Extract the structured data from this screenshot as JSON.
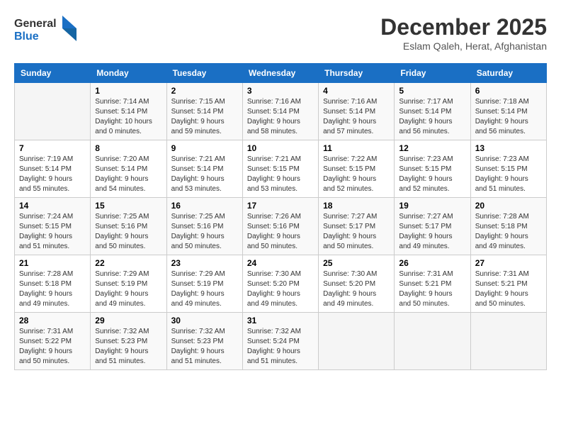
{
  "header": {
    "logo_line1": "General",
    "logo_line2": "Blue",
    "month_title": "December 2025",
    "location": "Eslam Qaleh, Herat, Afghanistan"
  },
  "weekdays": [
    "Sunday",
    "Monday",
    "Tuesday",
    "Wednesday",
    "Thursday",
    "Friday",
    "Saturday"
  ],
  "weeks": [
    [
      {
        "day": "",
        "sunrise": "",
        "sunset": "",
        "daylight": ""
      },
      {
        "day": "1",
        "sunrise": "Sunrise: 7:14 AM",
        "sunset": "Sunset: 5:14 PM",
        "daylight": "Daylight: 10 hours and 0 minutes."
      },
      {
        "day": "2",
        "sunrise": "Sunrise: 7:15 AM",
        "sunset": "Sunset: 5:14 PM",
        "daylight": "Daylight: 9 hours and 59 minutes."
      },
      {
        "day": "3",
        "sunrise": "Sunrise: 7:16 AM",
        "sunset": "Sunset: 5:14 PM",
        "daylight": "Daylight: 9 hours and 58 minutes."
      },
      {
        "day": "4",
        "sunrise": "Sunrise: 7:16 AM",
        "sunset": "Sunset: 5:14 PM",
        "daylight": "Daylight: 9 hours and 57 minutes."
      },
      {
        "day": "5",
        "sunrise": "Sunrise: 7:17 AM",
        "sunset": "Sunset: 5:14 PM",
        "daylight": "Daylight: 9 hours and 56 minutes."
      },
      {
        "day": "6",
        "sunrise": "Sunrise: 7:18 AM",
        "sunset": "Sunset: 5:14 PM",
        "daylight": "Daylight: 9 hours and 56 minutes."
      }
    ],
    [
      {
        "day": "7",
        "sunrise": "Sunrise: 7:19 AM",
        "sunset": "Sunset: 5:14 PM",
        "daylight": "Daylight: 9 hours and 55 minutes."
      },
      {
        "day": "8",
        "sunrise": "Sunrise: 7:20 AM",
        "sunset": "Sunset: 5:14 PM",
        "daylight": "Daylight: 9 hours and 54 minutes."
      },
      {
        "day": "9",
        "sunrise": "Sunrise: 7:21 AM",
        "sunset": "Sunset: 5:14 PM",
        "daylight": "Daylight: 9 hours and 53 minutes."
      },
      {
        "day": "10",
        "sunrise": "Sunrise: 7:21 AM",
        "sunset": "Sunset: 5:15 PM",
        "daylight": "Daylight: 9 hours and 53 minutes."
      },
      {
        "day": "11",
        "sunrise": "Sunrise: 7:22 AM",
        "sunset": "Sunset: 5:15 PM",
        "daylight": "Daylight: 9 hours and 52 minutes."
      },
      {
        "day": "12",
        "sunrise": "Sunrise: 7:23 AM",
        "sunset": "Sunset: 5:15 PM",
        "daylight": "Daylight: 9 hours and 52 minutes."
      },
      {
        "day": "13",
        "sunrise": "Sunrise: 7:23 AM",
        "sunset": "Sunset: 5:15 PM",
        "daylight": "Daylight: 9 hours and 51 minutes."
      }
    ],
    [
      {
        "day": "14",
        "sunrise": "Sunrise: 7:24 AM",
        "sunset": "Sunset: 5:15 PM",
        "daylight": "Daylight: 9 hours and 51 minutes."
      },
      {
        "day": "15",
        "sunrise": "Sunrise: 7:25 AM",
        "sunset": "Sunset: 5:16 PM",
        "daylight": "Daylight: 9 hours and 50 minutes."
      },
      {
        "day": "16",
        "sunrise": "Sunrise: 7:25 AM",
        "sunset": "Sunset: 5:16 PM",
        "daylight": "Daylight: 9 hours and 50 minutes."
      },
      {
        "day": "17",
        "sunrise": "Sunrise: 7:26 AM",
        "sunset": "Sunset: 5:16 PM",
        "daylight": "Daylight: 9 hours and 50 minutes."
      },
      {
        "day": "18",
        "sunrise": "Sunrise: 7:27 AM",
        "sunset": "Sunset: 5:17 PM",
        "daylight": "Daylight: 9 hours and 50 minutes."
      },
      {
        "day": "19",
        "sunrise": "Sunrise: 7:27 AM",
        "sunset": "Sunset: 5:17 PM",
        "daylight": "Daylight: 9 hours and 49 minutes."
      },
      {
        "day": "20",
        "sunrise": "Sunrise: 7:28 AM",
        "sunset": "Sunset: 5:18 PM",
        "daylight": "Daylight: 9 hours and 49 minutes."
      }
    ],
    [
      {
        "day": "21",
        "sunrise": "Sunrise: 7:28 AM",
        "sunset": "Sunset: 5:18 PM",
        "daylight": "Daylight: 9 hours and 49 minutes."
      },
      {
        "day": "22",
        "sunrise": "Sunrise: 7:29 AM",
        "sunset": "Sunset: 5:19 PM",
        "daylight": "Daylight: 9 hours and 49 minutes."
      },
      {
        "day": "23",
        "sunrise": "Sunrise: 7:29 AM",
        "sunset": "Sunset: 5:19 PM",
        "daylight": "Daylight: 9 hours and 49 minutes."
      },
      {
        "day": "24",
        "sunrise": "Sunrise: 7:30 AM",
        "sunset": "Sunset: 5:20 PM",
        "daylight": "Daylight: 9 hours and 49 minutes."
      },
      {
        "day": "25",
        "sunrise": "Sunrise: 7:30 AM",
        "sunset": "Sunset: 5:20 PM",
        "daylight": "Daylight: 9 hours and 49 minutes."
      },
      {
        "day": "26",
        "sunrise": "Sunrise: 7:31 AM",
        "sunset": "Sunset: 5:21 PM",
        "daylight": "Daylight: 9 hours and 50 minutes."
      },
      {
        "day": "27",
        "sunrise": "Sunrise: 7:31 AM",
        "sunset": "Sunset: 5:21 PM",
        "daylight": "Daylight: 9 hours and 50 minutes."
      }
    ],
    [
      {
        "day": "28",
        "sunrise": "Sunrise: 7:31 AM",
        "sunset": "Sunset: 5:22 PM",
        "daylight": "Daylight: 9 hours and 50 minutes."
      },
      {
        "day": "29",
        "sunrise": "Sunrise: 7:32 AM",
        "sunset": "Sunset: 5:23 PM",
        "daylight": "Daylight: 9 hours and 51 minutes."
      },
      {
        "day": "30",
        "sunrise": "Sunrise: 7:32 AM",
        "sunset": "Sunset: 5:23 PM",
        "daylight": "Daylight: 9 hours and 51 minutes."
      },
      {
        "day": "31",
        "sunrise": "Sunrise: 7:32 AM",
        "sunset": "Sunset: 5:24 PM",
        "daylight": "Daylight: 9 hours and 51 minutes."
      },
      {
        "day": "",
        "sunrise": "",
        "sunset": "",
        "daylight": ""
      },
      {
        "day": "",
        "sunrise": "",
        "sunset": "",
        "daylight": ""
      },
      {
        "day": "",
        "sunrise": "",
        "sunset": "",
        "daylight": ""
      }
    ]
  ]
}
